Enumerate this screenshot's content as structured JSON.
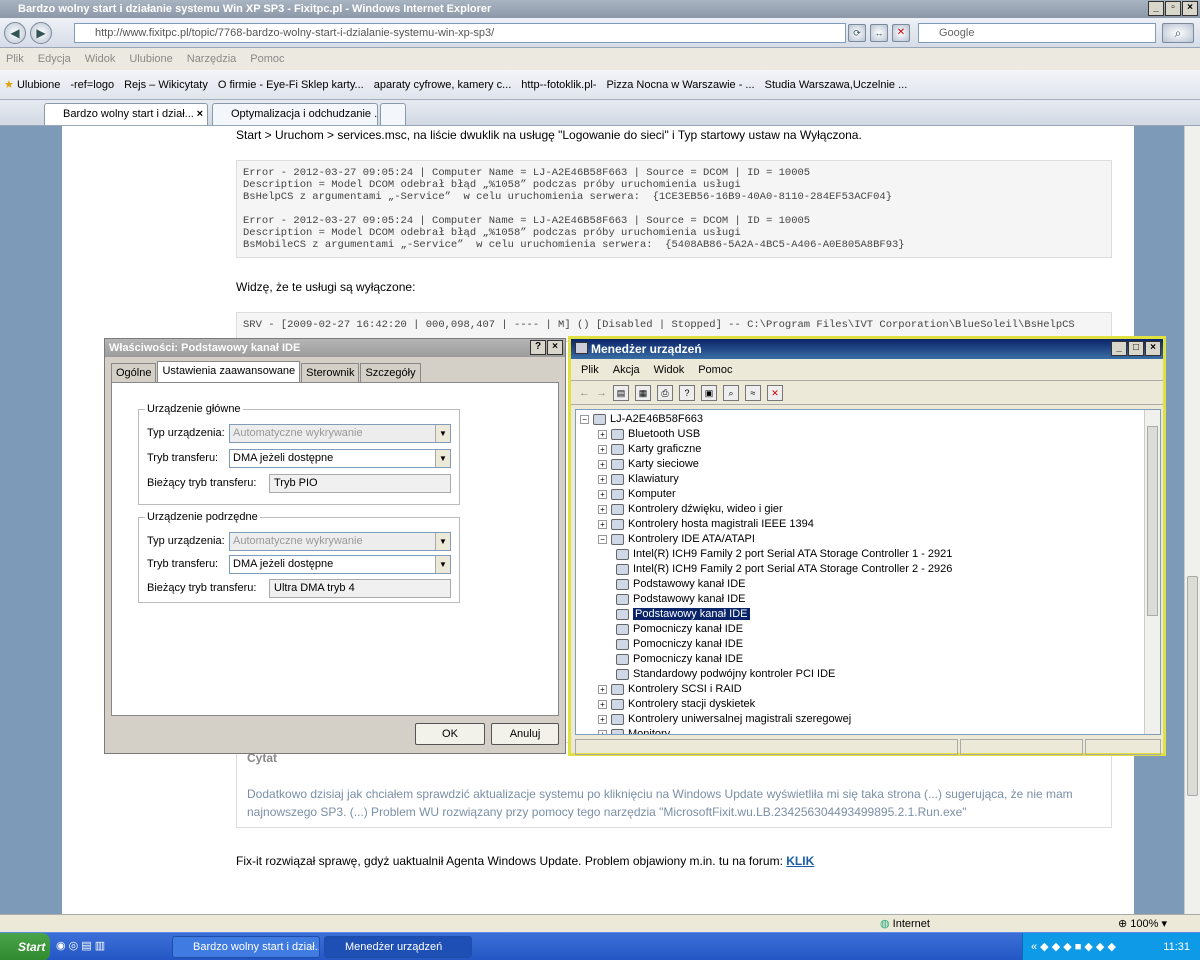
{
  "ie": {
    "title": "Bardzo wolny start i działanie systemu Win XP SP3 - Fixitpc.pl - Windows Internet Explorer",
    "address": "http://www.fixitpc.pl/topic/7768-bardzo-wolny-start-i-dzialanie-systemu-win-xp-sp3/",
    "search_placeholder": "Google",
    "menu": [
      "Plik",
      "Edycja",
      "Widok",
      "Ulubione",
      "Narzędzia",
      "Pomoc"
    ],
    "favorites_label": "Ulubione",
    "favorites": [
      "-ref=logo",
      "Rejs – Wikicytaty",
      "O firmie - Eye-Fi Sklep karty...",
      "aparaty cyfrowe, kamery c...",
      "http--fotoklik.pl-",
      "Pizza Nocna w Warszawie - ...",
      "Studia Warszawa,Uczelnie ..."
    ],
    "tabs": [
      "Bardzo wolny start i dział...",
      "Optymalizacja i odchudzanie ..."
    ],
    "status_zone": "Internet",
    "zoom": "100%"
  },
  "page": {
    "instruction": "Start > Uruchom > services.msc, na liście dwuklik na usługę \"Logowanie do sieci\" i Typ startowy ustaw na Wyłączona.",
    "code1": "Error - 2012-03-27 09:05:24 | Computer Name = LJ-A2E46B58F663 | Source = DCOM | ID = 10005\nDescription = Model DCOM odebrał błąd „%1058” podczas próby uruchomienia usługi\nBsHelpCS z argumentami „-Service”  w celu uruchomienia serwera:  {1CE3EB56-16B9-40A0-8110-284EF53ACF04}\n\nError - 2012-03-27 09:05:24 | Computer Name = LJ-A2E46B58F663 | Source = DCOM | ID = 10005\nDescription = Model DCOM odebrał błąd „%1058” podczas próby uruchomienia usługi\nBsMobileCS z argumentami „-Service”  w celu uruchomienia serwera:  {5408AB86-5A2A-4BC5-A406-A0E805A8BF93}",
    "para1": "Widzę, że te usługi są wyłączone:",
    "code2": "SRV - [2009-02-27 16:42:20 | 000,098,407 | ---- | M] () [Disabled | Stopped] -- C:\\Program Files\\IVT Corporation\\BlueSoleil\\BsHelpCS",
    "quote_label": "Cytat",
    "quote_text": "Dodatkowo dzisiaj jak chciałem sprawdzić aktualizacje systemu po kliknięciu na Windows Update wyświetliła mi się taka strona (...) sugerująca, że nie mam najnowszego SP3. (...) Problem WU rozwiązany przy pomocy tego narzędzia \"MicrosoftFixit.wu.LB.234256304493499895.2.1.Run.exe\"",
    "para2": "Fix-it rozwiązał sprawę, gdyż uaktualnił Agenta Windows Update. Problem objawiony m.in. tu na forum:",
    "link": "KLIK"
  },
  "props": {
    "title": "Właściwości: Podstawowy kanał IDE",
    "tabs": [
      "Ogólne",
      "Ustawienia zaawansowane",
      "Sterownik",
      "Szczegóły"
    ],
    "master": {
      "legend": "Urządzenie główne",
      "type_label": "Typ urządzenia:",
      "type_value": "Automatyczne wykrywanie",
      "mode_label": "Tryb transferu:",
      "mode_value": "DMA jeżeli dostępne",
      "current_label": "Bieżący tryb transferu:",
      "current_value": "Tryb PIO"
    },
    "slave": {
      "legend": "Urządzenie podrzędne",
      "type_label": "Typ urządzenia:",
      "type_value": "Automatyczne wykrywanie",
      "mode_label": "Tryb transferu:",
      "mode_value": "DMA jeżeli dostępne",
      "current_label": "Bieżący tryb transferu:",
      "current_value": "Ultra DMA tryb 4"
    },
    "ok": "OK",
    "cancel": "Anuluj"
  },
  "devmgr": {
    "title": "Menedżer urządzeń",
    "menu": [
      "Plik",
      "Akcja",
      "Widok",
      "Pomoc"
    ],
    "root": "LJ-A2E46B58F663",
    "nodes": [
      {
        "label": "Bluetooth USB",
        "level": 1,
        "exp": "+"
      },
      {
        "label": "Karty graficzne",
        "level": 1,
        "exp": "+"
      },
      {
        "label": "Karty sieciowe",
        "level": 1,
        "exp": "+"
      },
      {
        "label": "Klawiatury",
        "level": 1,
        "exp": "+"
      },
      {
        "label": "Komputer",
        "level": 1,
        "exp": "+"
      },
      {
        "label": "Kontrolery dźwięku, wideo i gier",
        "level": 1,
        "exp": "+"
      },
      {
        "label": "Kontrolery hosta magistrali IEEE 1394",
        "level": 1,
        "exp": "+"
      },
      {
        "label": "Kontrolery IDE ATA/ATAPI",
        "level": 1,
        "exp": "-"
      },
      {
        "label": "Intel(R) ICH9 Family 2 port Serial ATA Storage Controller 1 - 2921",
        "level": 2,
        "exp": ""
      },
      {
        "label": "Intel(R) ICH9 Family 2 port Serial ATA Storage Controller 2 - 2926",
        "level": 2,
        "exp": ""
      },
      {
        "label": "Podstawowy kanał IDE",
        "level": 2,
        "exp": ""
      },
      {
        "label": "Podstawowy kanał IDE",
        "level": 2,
        "exp": ""
      },
      {
        "label": "Podstawowy kanał IDE",
        "level": 2,
        "exp": "",
        "selected": true
      },
      {
        "label": "Pomocniczy kanał IDE",
        "level": 2,
        "exp": ""
      },
      {
        "label": "Pomocniczy kanał IDE",
        "level": 2,
        "exp": ""
      },
      {
        "label": "Pomocniczy kanał IDE",
        "level": 2,
        "exp": ""
      },
      {
        "label": "Standardowy podwójny kontroler PCI IDE",
        "level": 2,
        "exp": ""
      },
      {
        "label": "Kontrolery SCSI i RAID",
        "level": 1,
        "exp": "+"
      },
      {
        "label": "Kontrolery stacji dyskietek",
        "level": 1,
        "exp": "+"
      },
      {
        "label": "Kontrolery uniwersalnej magistrali szeregowej",
        "level": 1,
        "exp": "+"
      },
      {
        "label": "Monitory",
        "level": 1,
        "exp": "+"
      }
    ]
  },
  "taskbar": {
    "start": "Start",
    "items": [
      "Bardzo wolny start i dział...",
      "Menedżer urządzeń"
    ],
    "clock": "11:31"
  }
}
